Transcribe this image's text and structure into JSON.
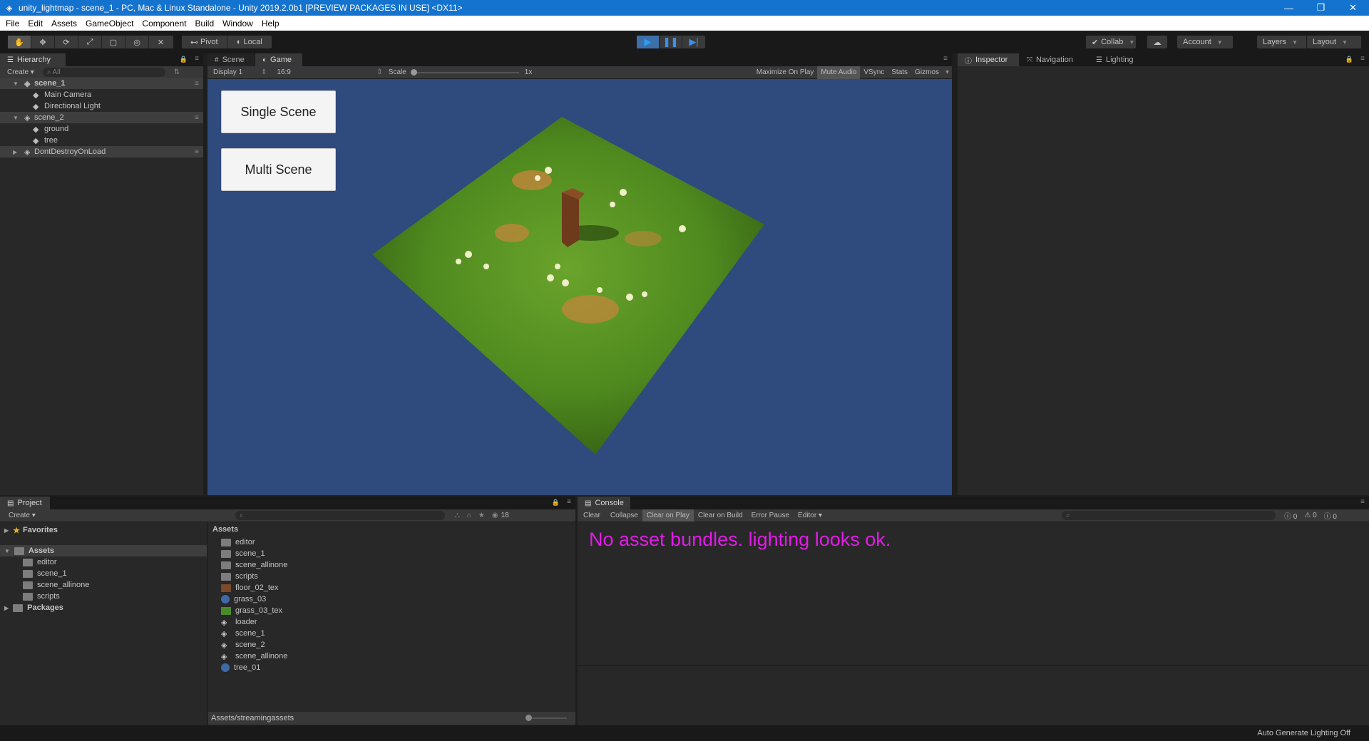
{
  "window": {
    "title": "unity_lightmap - scene_1 - PC, Mac & Linux Standalone - Unity 2019.2.0b1 [PREVIEW PACKAGES IN USE] <DX11>",
    "controls": [
      "—",
      "❐",
      "✕"
    ]
  },
  "menu": [
    "File",
    "Edit",
    "Assets",
    "GameObject",
    "Component",
    "Build",
    "Window",
    "Help"
  ],
  "toolbar": {
    "pivot": "Pivot",
    "local": "Local",
    "collab": "Collab",
    "account": "Account",
    "layers": "Layers",
    "layout": "Layout"
  },
  "hierarchy": {
    "tab": "Hierarchy",
    "create": "Create",
    "search_placeholder": "All",
    "items": [
      {
        "label": "scene_1",
        "type": "scene"
      },
      {
        "label": "Main Camera",
        "type": "object"
      },
      {
        "label": "Directional Light",
        "type": "object"
      },
      {
        "label": "scene_2",
        "type": "scene"
      },
      {
        "label": "ground",
        "type": "object"
      },
      {
        "label": "tree",
        "type": "object"
      },
      {
        "label": "DontDestroyOnLoad",
        "type": "scene"
      }
    ]
  },
  "game": {
    "tabs": [
      "Scene",
      "Game"
    ],
    "display": "Display 1",
    "aspect": "16:9",
    "scale_label": "Scale",
    "scale_value": "1x",
    "options": [
      "Maximize On Play",
      "Mute Audio",
      "VSync",
      "Stats",
      "Gizmos"
    ],
    "buttons": [
      "Single Scene",
      "Multi Scene"
    ],
    "colors": {
      "background": "#2f4a7c",
      "grass": "#4f8a1f"
    }
  },
  "inspector": {
    "tabs": [
      "Inspector",
      "Navigation",
      "Lighting"
    ]
  },
  "project": {
    "tab": "Project",
    "create": "Create",
    "count": "18",
    "tree": [
      {
        "label": "Favorites",
        "level": 0,
        "icon": "star"
      },
      {
        "label": "Assets",
        "level": 0,
        "icon": "folder"
      },
      {
        "label": "editor",
        "level": 1,
        "icon": "folder"
      },
      {
        "label": "scene_1",
        "level": 1,
        "icon": "folder"
      },
      {
        "label": "scene_allinone",
        "level": 1,
        "icon": "folder"
      },
      {
        "label": "scripts",
        "level": 1,
        "icon": "folder"
      },
      {
        "label": "Packages",
        "level": 0,
        "icon": "folder"
      }
    ],
    "assets_header": "Assets",
    "assets": [
      {
        "label": "editor",
        "icon": "folder"
      },
      {
        "label": "scene_1",
        "icon": "folder"
      },
      {
        "label": "scene_allinone",
        "icon": "folder"
      },
      {
        "label": "scripts",
        "icon": "folder"
      },
      {
        "label": "floor_02_tex",
        "icon": "texture-floor"
      },
      {
        "label": "grass_03",
        "icon": "material"
      },
      {
        "label": "grass_03_tex",
        "icon": "texture-grass"
      },
      {
        "label": "loader",
        "icon": "scene"
      },
      {
        "label": "scene_1",
        "icon": "scene"
      },
      {
        "label": "scene_2",
        "icon": "scene"
      },
      {
        "label": "scene_allinone",
        "icon": "scene"
      },
      {
        "label": "tree_01",
        "icon": "material"
      }
    ],
    "path": "Assets/streamingassets"
  },
  "console": {
    "tab": "Console",
    "buttons": [
      "Clear",
      "Collapse",
      "Clear on Play",
      "Clear on Build",
      "Error Pause",
      "Editor"
    ],
    "counts": {
      "log": "0",
      "warn": "0",
      "error": "0"
    },
    "message": "No asset bundles. lighting looks ok."
  },
  "statusbar": {
    "text": "Auto Generate Lighting Off"
  }
}
